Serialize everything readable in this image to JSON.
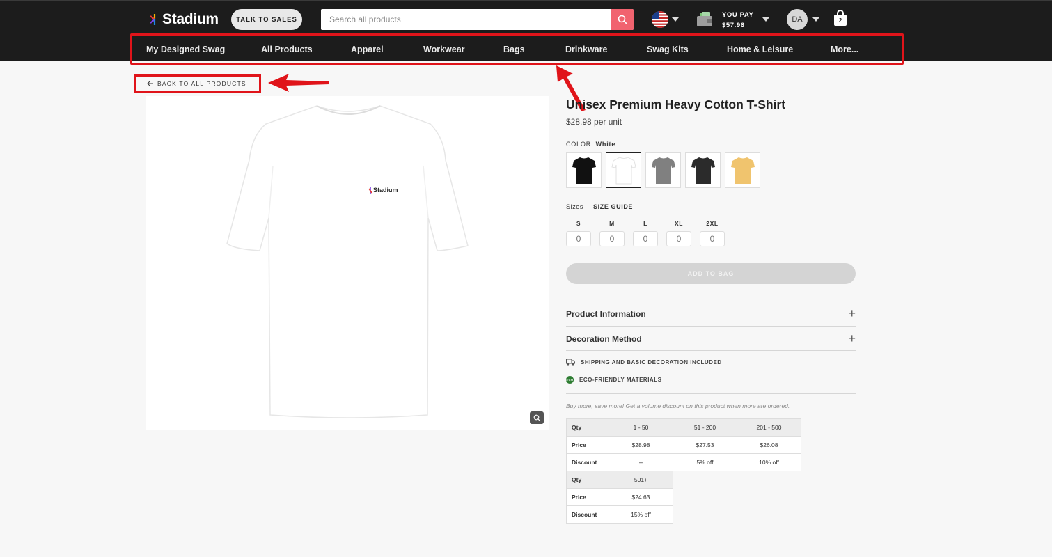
{
  "header": {
    "logo_text": "Stadium",
    "talk_to_sales": "TALK TO SALES",
    "search_placeholder": "Search all products",
    "you_pay_label": "YOU PAY",
    "you_pay_amount": "$57.96",
    "avatar_initials": "DA",
    "bag_count": "2"
  },
  "nav": {
    "items": [
      "My Designed Swag",
      "All Products",
      "Apparel",
      "Workwear",
      "Bags",
      "Drinkware",
      "Swag Kits",
      "Home & Leisure",
      "More..."
    ]
  },
  "back_link": "BACK TO ALL PRODUCTS",
  "product": {
    "image_logo_text": "Stadium",
    "title": "Unisex Premium Heavy Cotton T-Shirt",
    "price": "$28.98 per unit",
    "color_label": "COLOR:",
    "color_value": "White",
    "swatches": [
      {
        "name": "Black",
        "color": "#111111"
      },
      {
        "name": "White",
        "color": "#ffffff"
      },
      {
        "name": "Gray",
        "color": "#808080"
      },
      {
        "name": "Charcoal",
        "color": "#2b2b2b"
      },
      {
        "name": "Mustard",
        "color": "#f0c46e"
      }
    ],
    "sizes_label": "Sizes",
    "size_guide": "SIZE GUIDE",
    "sizes": [
      {
        "label": "S",
        "value": "0"
      },
      {
        "label": "M",
        "value": "0"
      },
      {
        "label": "L",
        "value": "0"
      },
      {
        "label": "XL",
        "value": "0"
      },
      {
        "label": "2XL",
        "value": "0"
      }
    ],
    "add_to_bag": "ADD TO BAG",
    "accordions": [
      "Product Information",
      "Decoration Method"
    ],
    "features": [
      "SHIPPING AND BASIC DECORATION INCLUDED",
      "ECO-FRIENDLY MATERIALS"
    ],
    "eco_badge": "ECO",
    "volume_note": "Buy more, save more! Get a volume discount on this product when more are ordered.",
    "pricing_table_1": {
      "rows": [
        [
          "Qty",
          "1 - 50",
          "51 - 200",
          "201 - 500"
        ],
        [
          "Price",
          "$28.98",
          "$27.53",
          "$26.08"
        ],
        [
          "Discount",
          "--",
          "5% off",
          "10% off"
        ]
      ]
    },
    "pricing_table_2": {
      "rows": [
        [
          "Qty",
          "501+"
        ],
        [
          "Price",
          "$24.63"
        ],
        [
          "Discount",
          "15% off"
        ]
      ]
    }
  },
  "colors": {
    "header_bg": "#1c1c1c",
    "search_button": "#f1636f",
    "annotation_red": "#e0141a"
  }
}
